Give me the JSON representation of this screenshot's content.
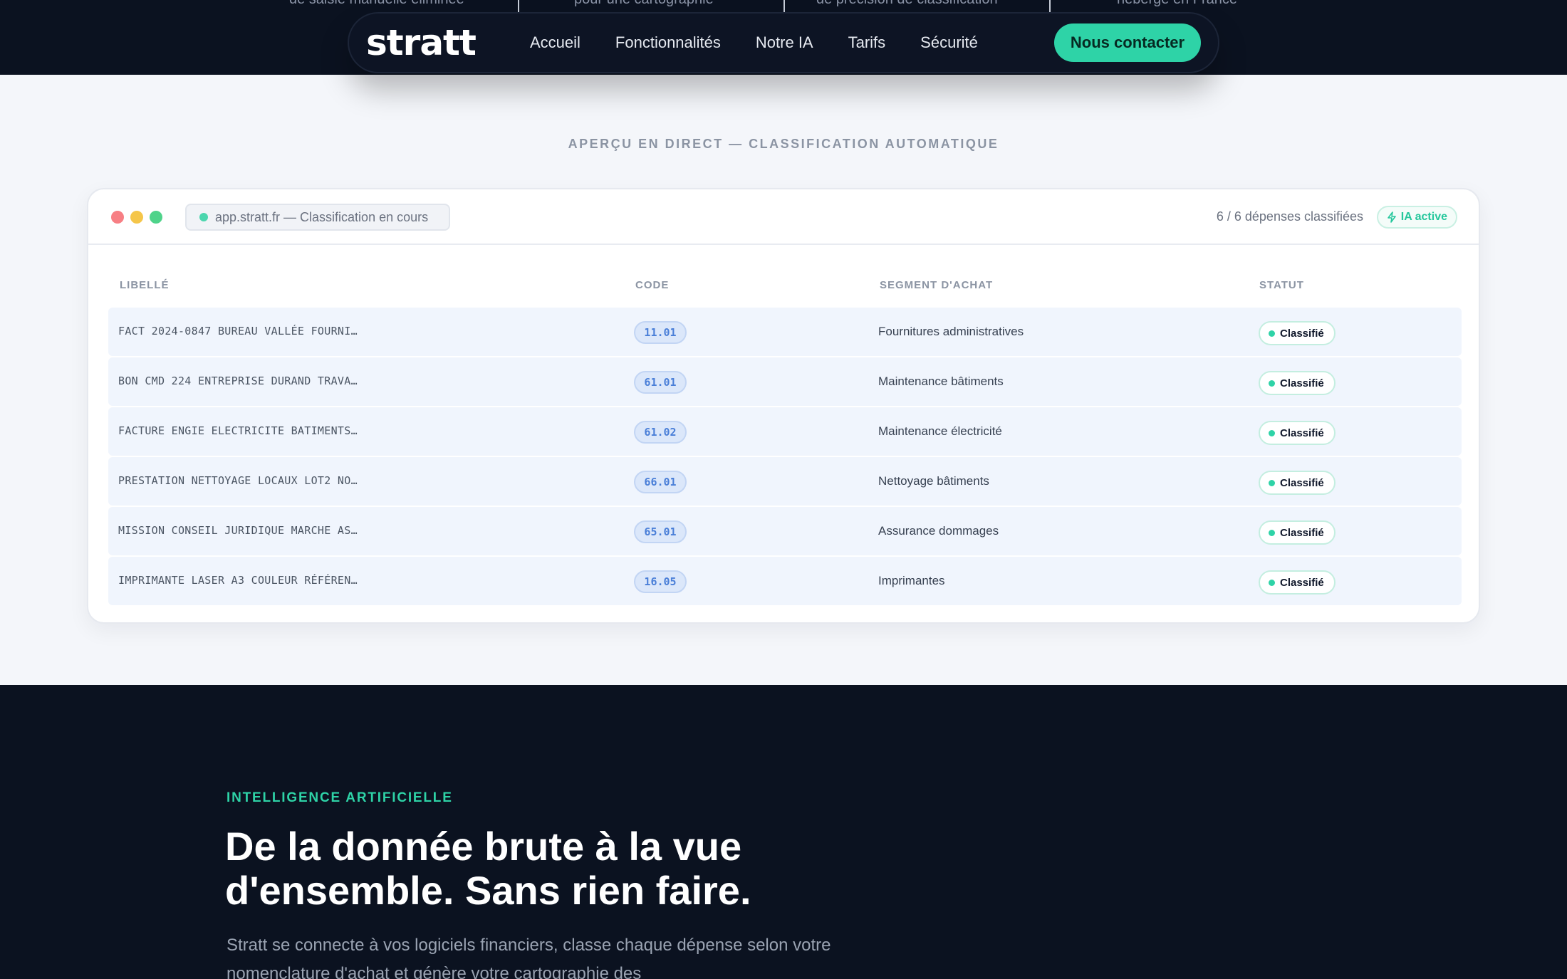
{
  "stats_strip": {
    "items": [
      "de saisie manuelle éliminée",
      "pour une cartographie",
      "de précision de classification",
      "hébergé en France"
    ]
  },
  "navbar": {
    "logo": "stratt",
    "links": [
      "Accueil",
      "Fonctionnalités",
      "Notre IA",
      "Tarifs",
      "Sécurité"
    ],
    "cta": "Nous contacter"
  },
  "live_preview": {
    "label": "APERÇU EN DIRECT — CLASSIFICATION AUTOMATIQUE",
    "url": "app.stratt.fr — Classification en cours",
    "count": "6 / 6 dépenses classifiées",
    "ia_badge": "IA active",
    "headers": {
      "libelle": "LIBELLÉ",
      "code": "CODE",
      "segment": "SEGMENT D'ACHAT",
      "statut": "STATUT"
    },
    "rows": [
      {
        "libelle": "FACT 2024-0847 BUREAU VALLÉE FOURNI…",
        "code": "11.01",
        "segment": "Fournitures administratives",
        "statut": "Classifié"
      },
      {
        "libelle": "BON CMD 224 ENTREPRISE DURAND TRAVA…",
        "code": "61.01",
        "segment": "Maintenance bâtiments",
        "statut": "Classifié"
      },
      {
        "libelle": "FACTURE ENGIE ELECTRICITE BATIMENTS…",
        "code": "61.02",
        "segment": "Maintenance électricité",
        "statut": "Classifié"
      },
      {
        "libelle": "PRESTATION NETTOYAGE LOCAUX LOT2 NO…",
        "code": "66.01",
        "segment": "Nettoyage bâtiments",
        "statut": "Classifié"
      },
      {
        "libelle": "MISSION CONSEIL JURIDIQUE MARCHE AS…",
        "code": "65.01",
        "segment": "Assurance dommages",
        "statut": "Classifié"
      },
      {
        "libelle": "IMPRIMANTE LASER A3 COULEUR RÉFÉREN…",
        "code": "16.05",
        "segment": "Imprimantes",
        "statut": "Classifié"
      }
    ]
  },
  "ai_section": {
    "eyebrow": "INTELLIGENCE ARTIFICIELLE",
    "headline_line1": "De la donnée brute à la vue",
    "headline_line2": "d'ensemble. Sans rien faire.",
    "paragraph": "Stratt se connecte à vos logiciels financiers, classe chaque dépense selon votre nomenclature d'achat et génère votre cartographie des"
  },
  "colors": {
    "dark_bg": "#0b1220",
    "accent": "#2ed3a7",
    "code_blue": "#4a7fd8"
  }
}
